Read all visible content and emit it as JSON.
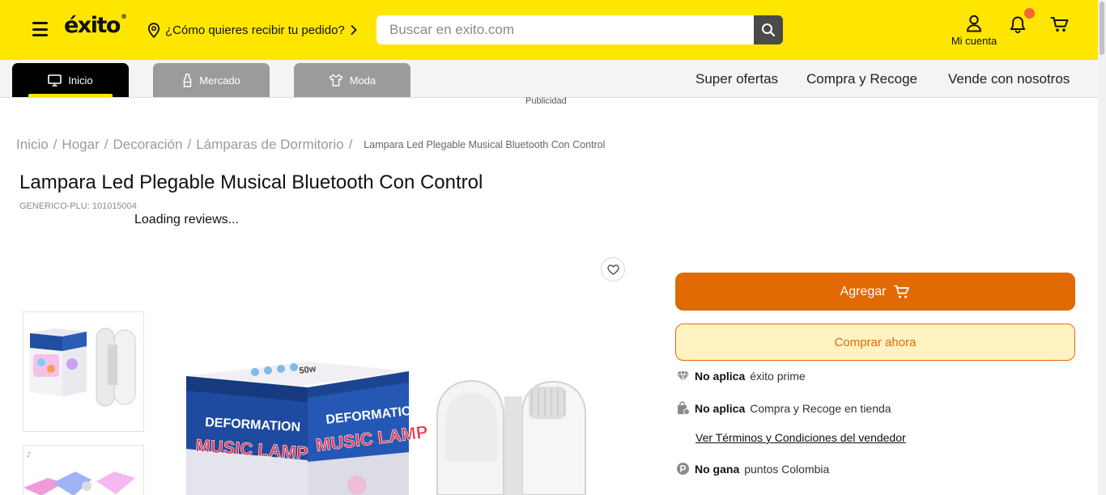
{
  "header": {
    "logo_text": "éxito",
    "delivery_prompt": "¿Cómo quieres recibir tu pedido?",
    "search_placeholder": "Buscar en exito.com",
    "account_label": "Mi cuenta",
    "accent": "#ffe600",
    "notification_color": "#f4663a"
  },
  "nav": {
    "tabs": [
      {
        "label": "Inicio",
        "icon": "monitor-icon",
        "active": true
      },
      {
        "label": "Mercado",
        "icon": "bottle-icon",
        "active": false
      },
      {
        "label": "Moda",
        "icon": "shirt-icon",
        "active": false
      }
    ],
    "links": [
      "Super ofertas",
      "Compra y Recoge",
      "Vende con nosotros"
    ]
  },
  "ad_label": "Publicidad",
  "breadcrumb": {
    "items": [
      "Inicio",
      "Hogar",
      "Decoración",
      "Lámparas de Dormitorio"
    ],
    "current": "Lampara Led Plegable Musical Bluetooth Con Control"
  },
  "product": {
    "title": "Lampara Led Plegable Musical Bluetooth Con Control",
    "plu": "GENERICO-PLU: 101015004",
    "reviews_status": "Loading reviews...",
    "box_text_line1": "DEFORMATION",
    "box_text_line2": "MUSIC LAMP",
    "box_watts": "50w"
  },
  "buybox": {
    "add_label": "Agregar",
    "buy_now_label": "Comprar ahora",
    "add_color": "#e16a04",
    "prime": {
      "bold": "No aplica",
      "text": "éxito prime"
    },
    "pickup": {
      "bold": "No aplica",
      "text": "Compra y Recoge en tienda"
    },
    "terms_link": "Ver Términos y Condiciones del vendedor",
    "points": {
      "bold": "No gana",
      "text": "puntos Colombia"
    }
  }
}
